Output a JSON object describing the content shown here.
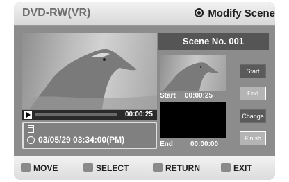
{
  "window": {
    "app_title": "DVD-RW(VR)",
    "mode_title": "Modify Scene"
  },
  "player": {
    "elapsed": "00:00:25",
    "progress": 0.0
  },
  "info": {
    "datetime": "03/05/29 03:34:00(PM)"
  },
  "scene": {
    "header": "Scene No. 001",
    "start_label": "Start",
    "start_time": "00:00:25",
    "end_label": "End",
    "end_time": "00:00:00"
  },
  "buttons": {
    "start": "Start",
    "end": "End",
    "change": "Change",
    "finish": "Finish"
  },
  "footer": {
    "move": "MOVE",
    "select": "SELECT",
    "return": "RETURN",
    "exit": "EXIT"
  }
}
